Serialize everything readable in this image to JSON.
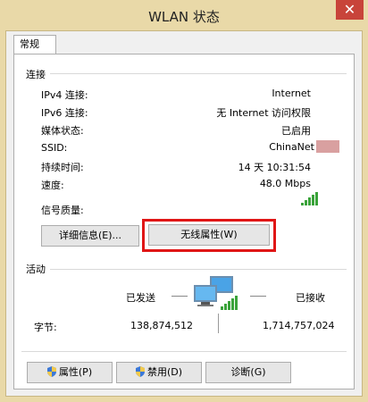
{
  "window": {
    "title": "WLAN 状态",
    "close_glyph": "✕"
  },
  "tabs": [
    {
      "label": "常规"
    }
  ],
  "connection": {
    "section_label": "连接",
    "rows": [
      {
        "label": "IPv4 连接:",
        "value": "Internet"
      },
      {
        "label": "IPv6 连接:",
        "value": "无 Internet 访问权限"
      },
      {
        "label": "媒体状态:",
        "value": "已启用"
      },
      {
        "label": "SSID:",
        "value": "ChinaNet"
      },
      {
        "label": "持续时间:",
        "value": "14 天 10:31:54"
      },
      {
        "label": "速度:",
        "value": "48.0 Mbps"
      }
    ],
    "signal_label": "信号质量:",
    "signal_bars_filled": 5,
    "signal_bars_total": 5,
    "details_button": "详细信息(E)...",
    "wireless_props_button": "无线属性(W)"
  },
  "activity": {
    "section_label": "活动",
    "sent_label": "已发送",
    "received_label": "已接收",
    "bytes_label": "字节:",
    "bytes_sent": "138,874,512",
    "bytes_received": "1,714,757,024"
  },
  "bottom_buttons": {
    "properties": "属性(P)",
    "disable": "禁用(D)",
    "diagnose": "诊断(G)"
  },
  "colors": {
    "highlight": "#e01616",
    "title_bg": "#e9d9a8",
    "signal": "#3aa33a"
  }
}
